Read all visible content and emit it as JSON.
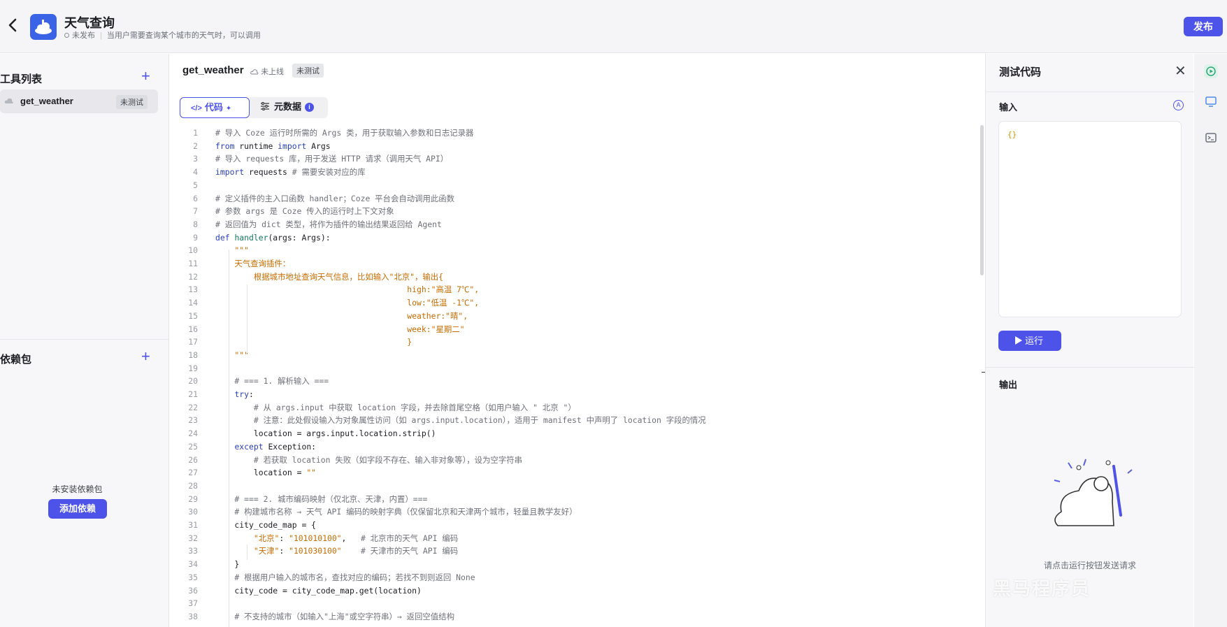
{
  "header": {
    "app_name": "天气查询",
    "status": "未发布",
    "description": "当用户需要查询某个城市的天气时，可以调用",
    "publish_label": "发布"
  },
  "left_panel": {
    "tools_title": "工具列表",
    "tools": [
      {
        "name": "get_weather",
        "badge": "未测试"
      }
    ],
    "deps_title": "依赖包",
    "no_deps_text": "未安装依赖包",
    "add_deps_label": "添加依赖"
  },
  "editor": {
    "tool_name": "get_weather",
    "online_status": "未上线",
    "test_badge": "未测试",
    "tabs": [
      {
        "label": "代码",
        "active": true
      },
      {
        "label": "元数据",
        "active": false
      }
    ],
    "code_lines": [
      "# 导入 Coze 运行时所需的 Args 类，用于获取输入参数和日志记录器",
      "from runtime import Args",
      "# 导入 requests 库，用于发送 HTTP 请求（调用天气 API）",
      "import requests # 需要安装对应的库",
      "",
      "# 定义插件的主入口函数 handler；Coze 平台会自动调用此函数",
      "# 参数 args 是 Coze 传入的运行时上下文对象",
      "# 返回值为 dict 类型，将作为插件的输出结果返回给 Agent",
      "def handler(args: Args):",
      "    \"\"\"",
      "    天气查询插件：",
      "        根据城市地址查询天气信息，比如输入\"北京\"，输出{",
      "                                        high:\"高温 7℃\",",
      "                                        low:\"低温 -1℃\",",
      "                                        weather:\"晴\",",
      "                                        week:\"星期二\"",
      "                                        }",
      "    \"\"\"",
      "",
      "    # === 1. 解析输入 ===",
      "    try:",
      "        # 从 args.input 中获取 location 字段，并去除首尾空格（如用户输入 \" 北京 \"）",
      "        # 注意：此处假设输入为对象属性访问（如 args.input.location），适用于 manifest 中声明了 location 字段的情况",
      "        location = args.input.location.strip()",
      "    except Exception:",
      "        # 若获取 location 失败（如字段不存在、输入非对象等），设为空字符串",
      "        location = \"\"",
      "",
      "    # === 2. 城市编码映射（仅北京、天津，内置）===",
      "    # 构建城市名称 → 天气 API 编码的映射字典（仅保留北京和天津两个城市，轻量且教学友好）",
      "    city_code_map = {",
      "        \"北京\": \"101010100\",   # 北京市的天气 API 编码",
      "        \"天津\": \"101030100\"    # 天津市的天气 API 编码",
      "    }",
      "    # 根据用户输入的城市名，查找对应的编码；若找不到则返回 None",
      "    city_code = city_code_map.get(location)",
      "",
      "    # 不支持的城市（如输入\"上海\"或空字符串）→ 返回空值结构"
    ]
  },
  "test_panel": {
    "title": "测试代码",
    "input_label": "输入",
    "input_value": "{}",
    "run_label": "运行",
    "output_label": "输出",
    "hint": "请点击运行按钮发送请求"
  },
  "watermark": "黑马程序员",
  "colors": {
    "accent": "#4d53e8",
    "keyword": "#2a3fb7",
    "string": "#c76c00",
    "comment": "#6f7179"
  }
}
